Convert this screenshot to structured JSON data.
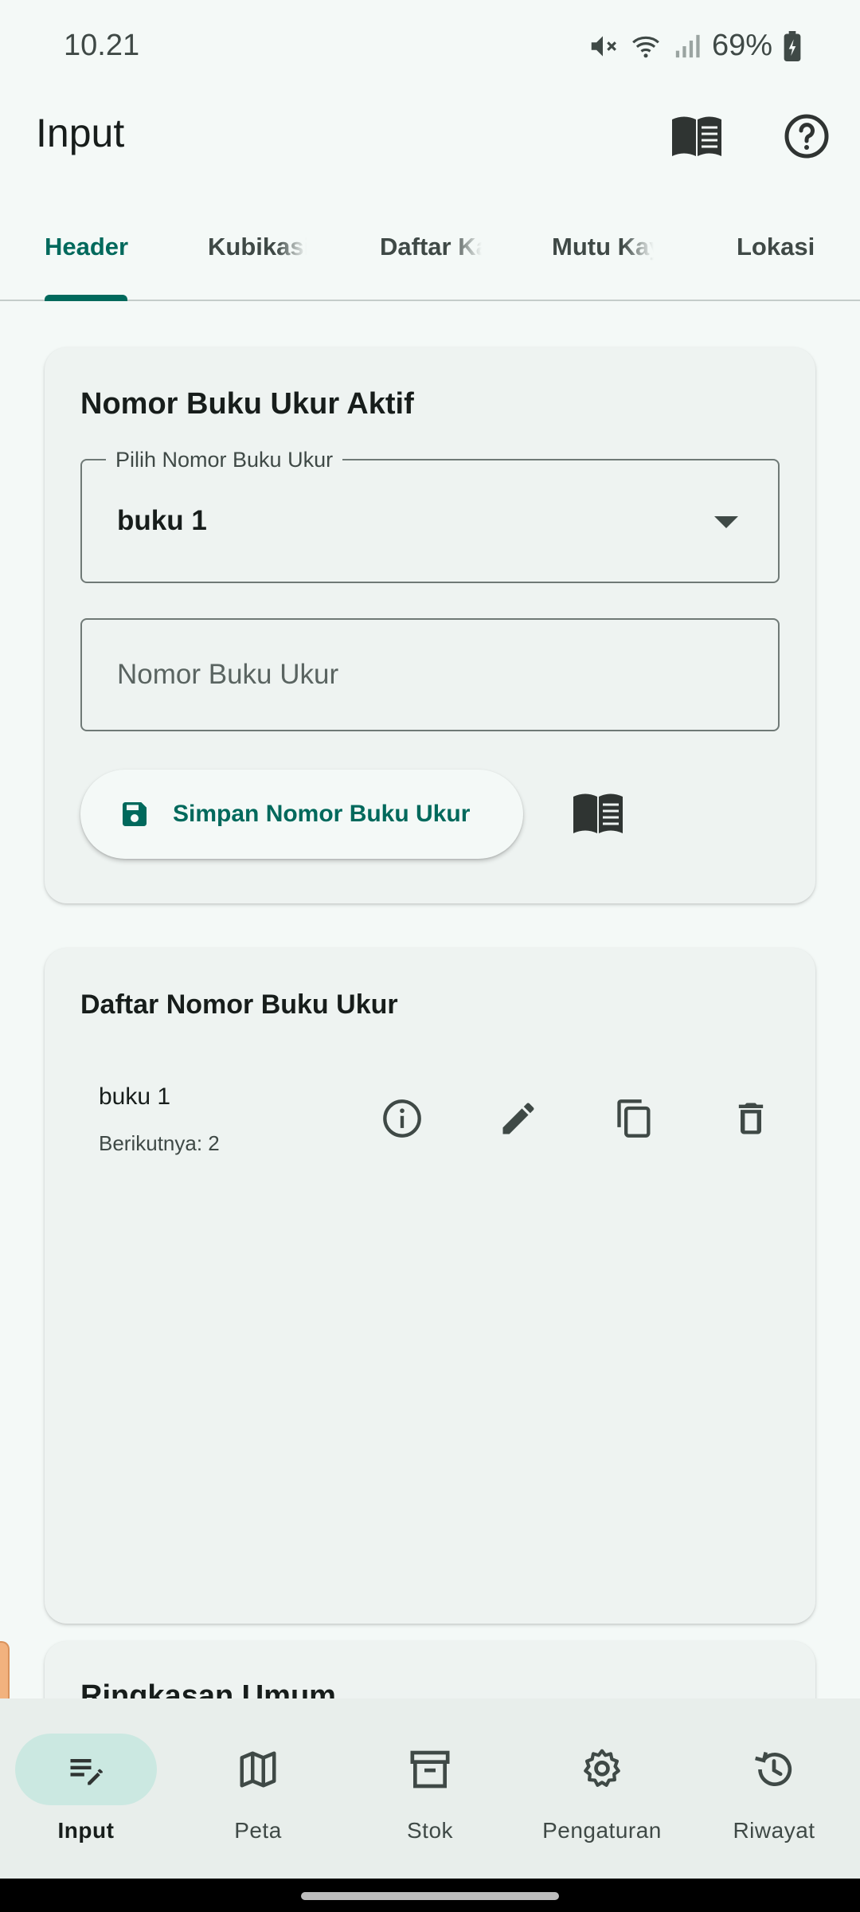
{
  "status_bar": {
    "time": "10.21",
    "battery": "69%"
  },
  "app_bar": {
    "title": "Input"
  },
  "tabs": [
    {
      "label": "Header",
      "active": true
    },
    {
      "label": "Kubikasi",
      "active": false
    },
    {
      "label": "Daftar Ka",
      "active": false
    },
    {
      "label": "Mutu Kay",
      "active": false
    },
    {
      "label": "Lokasi",
      "active": false
    }
  ],
  "active_card": {
    "title": "Nomor Buku Ukur Aktif",
    "select_label": "Pilih Nomor Buku Ukur",
    "select_value": "buku 1",
    "input_placeholder": "Nomor Buku Ukur",
    "input_value": "",
    "save_label": "Simpan Nomor Buku Ukur"
  },
  "list_card": {
    "title": "Daftar Nomor Buku Ukur",
    "items": [
      {
        "title": "buku 1",
        "subtitle": "Berikutnya: 2"
      }
    ]
  },
  "summary_card": {
    "title": "Ringkasan Umum"
  },
  "bottom_nav": [
    {
      "label": "Input",
      "icon": "edit-note-icon",
      "active": true
    },
    {
      "label": "Peta",
      "icon": "map-icon",
      "active": false
    },
    {
      "label": "Stok",
      "icon": "archive-icon",
      "active": false
    },
    {
      "label": "Pengaturan",
      "icon": "gear-icon",
      "active": false
    },
    {
      "label": "Riwayat",
      "icon": "history-icon",
      "active": false
    }
  ],
  "colors": {
    "accent": "#00695c",
    "background": "#f4f9f7",
    "card": "#eef3f1",
    "nav_active": "#cbe8e1"
  }
}
